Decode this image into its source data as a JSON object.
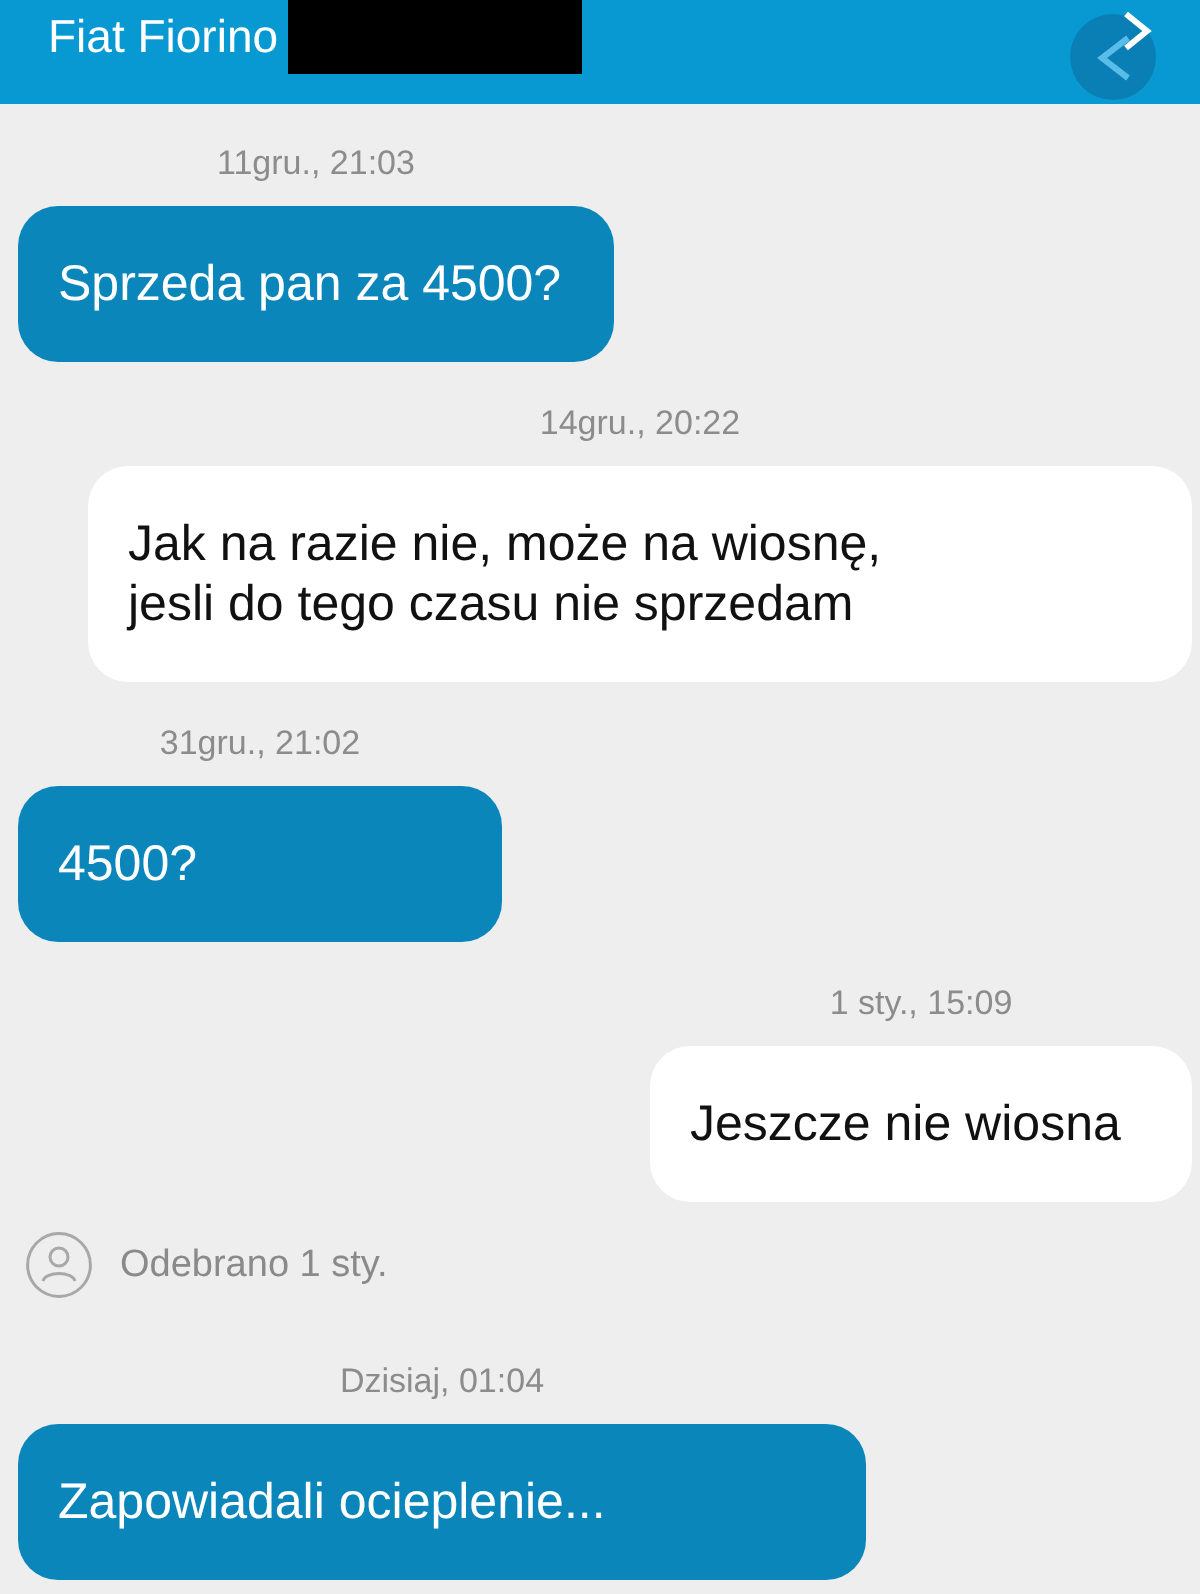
{
  "header": {
    "title": "Fiat Fiorino",
    "redacted": true
  },
  "thread": [
    {
      "kind": "sent",
      "time": "11gru., 21:03",
      "text": "Sprzeda pan za 4500?"
    },
    {
      "kind": "received",
      "time": "14gru., 20:22",
      "text": "Jak na razie nie, może na wiosnę,\njesli do tego czasu nie sprzedam"
    },
    {
      "kind": "sent",
      "time": "31gru., 21:02",
      "text": "4500?"
    },
    {
      "kind": "received",
      "time": "1 sty., 15:09",
      "text": "Jeszcze nie wiosna"
    },
    {
      "kind": "receipt",
      "text": "Odebrano 1 sty."
    },
    {
      "kind": "sent",
      "time": "Dzisiaj, 01:04",
      "text": "Zapowiadali ocieplenie..."
    }
  ]
}
